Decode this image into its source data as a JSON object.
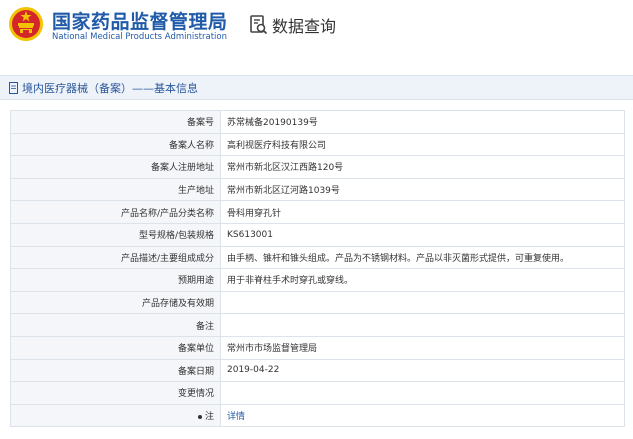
{
  "header": {
    "site_name_cn": "国家药品监督管理局",
    "site_name_en": "National Medical Products Administration",
    "query_label": "数据查询"
  },
  "section": {
    "title": "境内医疗器械（备案）——基本信息"
  },
  "rows": [
    {
      "label": "备案号",
      "value": "苏常械备20190139号"
    },
    {
      "label": "备案人名称",
      "value": "高利视医疗科技有限公司"
    },
    {
      "label": "备案人注册地址",
      "value": "常州市新北区汉江西路120号"
    },
    {
      "label": "生产地址",
      "value": "常州市新北区辽河路1039号"
    },
    {
      "label": "产品名称/产品分类名称",
      "value": "骨科用穿孔针"
    },
    {
      "label": "型号规格/包装规格",
      "value": "KS613001"
    },
    {
      "label": "产品描述/主要组成成分",
      "value": "由手柄、锥杆和锥头组成。产品为不锈钢材料。产品以非灭菌形式提供，可重复使用。"
    },
    {
      "label": "预期用途",
      "value": "用于非脊柱手术时穿孔或穿线。"
    },
    {
      "label": "产品存储及有效期",
      "value": ""
    },
    {
      "label": "备注",
      "value": ""
    },
    {
      "label": "备案单位",
      "value": "常州市市场监督管理局"
    },
    {
      "label": "备案日期",
      "value": "2019-04-22"
    },
    {
      "label": "变更情况",
      "value": ""
    },
    {
      "label": "注",
      "value": "详情"
    }
  ],
  "colors": {
    "brand_blue": "#1f5ba8",
    "emblem_red": "#d4252a",
    "emblem_gold": "#f3c200"
  }
}
